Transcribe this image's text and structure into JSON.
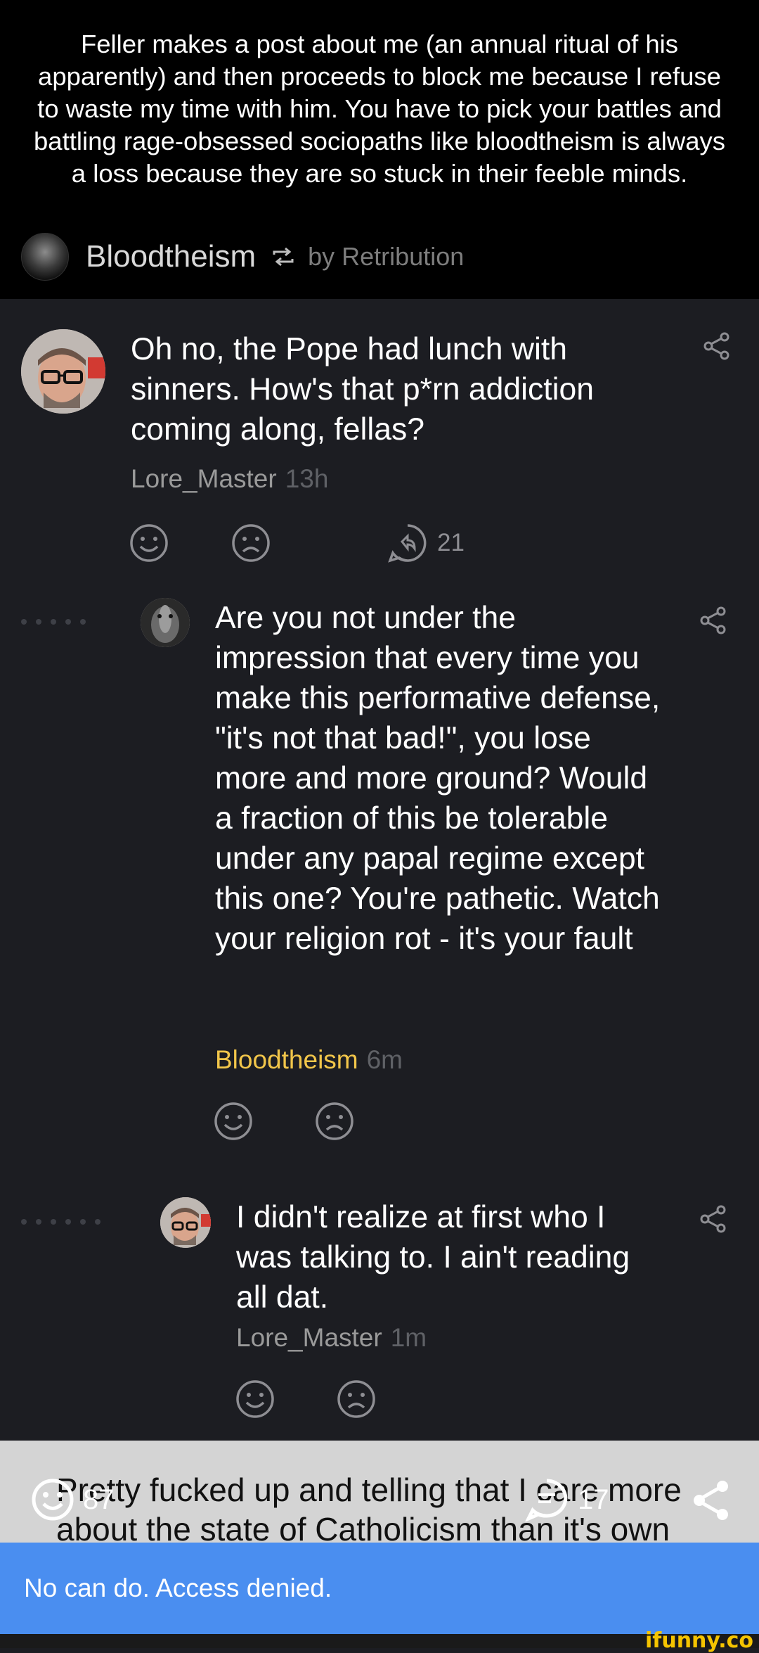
{
  "caption": {
    "text": "Feller makes a post about me (an annual ritual of his apparently) and then proceeds to block me because I refuse to waste my time with him. You have to pick your battles and battling rage-obsessed sociopaths like bloodtheism is always a loss because they are so stuck in their feeble minds."
  },
  "repost": {
    "author": "Bloodtheism",
    "by": "by Retribution"
  },
  "comments": [
    {
      "text": "Oh no, the Pope had lunch with sinners. How's that p*rn addiction coming along, fellas?",
      "author": "Lore_Master",
      "time": "13h",
      "replies_count": "21"
    },
    {
      "text": "Are you not under the impression that every time you make this performative defense, \"it's not that bad!\", you lose more and more ground? Would a fraction of this be tolerable under any papal regime except this one? You're pathetic. Watch your religion rot - it's your fault",
      "author": "Bloodtheism",
      "time": "6m"
    },
    {
      "text": "I didn't realize at first who I was talking to. I ain't reading all dat.",
      "author": "Lore_Master",
      "time": "1m"
    }
  ],
  "bottom_strip": {
    "text": "Pretty fucked up and telling that I care more about the state of Catholicism than it's own",
    "smile_count": "87",
    "comment_count": "17"
  },
  "toast": {
    "text": "No can do. Access denied."
  },
  "watermark": "ifunny.co",
  "colors": {
    "background": "#1c1d22",
    "toast": "#4a8ef0",
    "highlight_author": "#f2c64a"
  }
}
